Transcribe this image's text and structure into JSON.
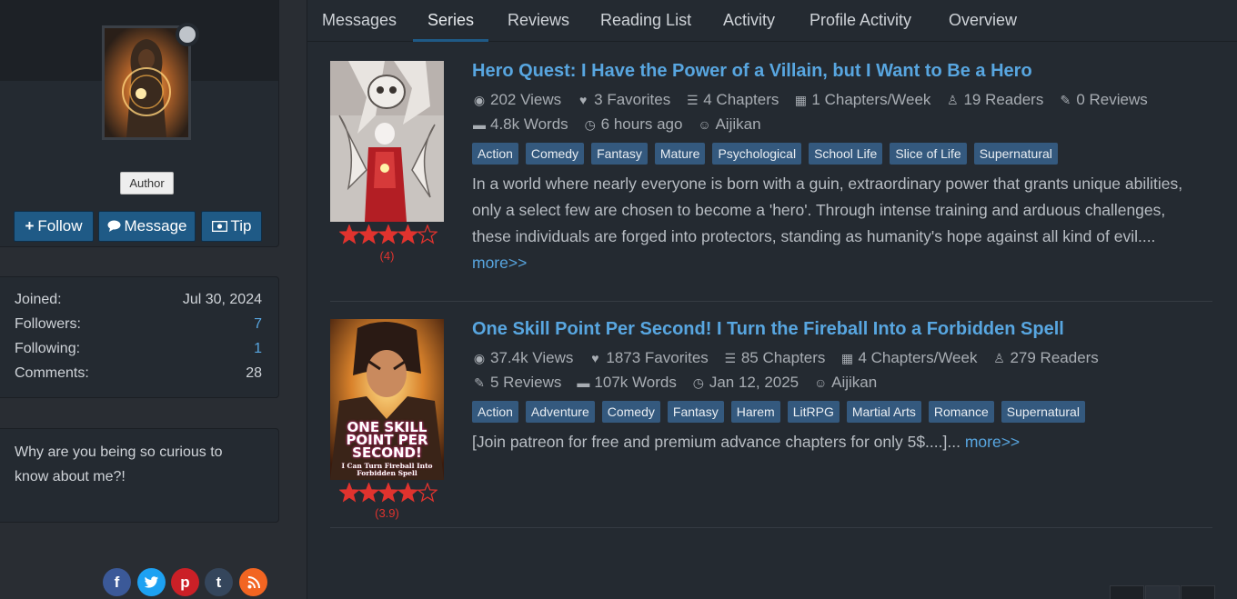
{
  "profile": {
    "username": "Aijikan",
    "badge": "Author",
    "buttons": {
      "follow": "Follow",
      "message": "Message",
      "tip": "Tip"
    }
  },
  "stats": [
    {
      "label": "Joined:",
      "value": "Jul 30, 2024"
    },
    {
      "label": "Followers:",
      "value": "7"
    },
    {
      "label": "Following:",
      "value": "1"
    },
    {
      "label": "Comments:",
      "value": "28"
    }
  ],
  "about": "Why are you being so curious to know about me?!",
  "social_icons": [
    "facebook-icon",
    "twitter-icon",
    "pinterest-icon",
    "tumblr-icon",
    "rss-icon"
  ],
  "tabs": [
    "Messages",
    "Series",
    "Reviews",
    "Reading List",
    "Activity",
    "Profile Activity",
    "Overview"
  ],
  "active_tab": "Series",
  "series": [
    {
      "title": "Hero Quest: I Have the Power of a Villain, but I Want to Be a Hero",
      "rating": 4,
      "rating_label": "(4)",
      "meta_line1": [
        {
          "icon": "eye-icon",
          "text": "202 Views"
        },
        {
          "icon": "heart-icon",
          "text": "3 Favorites"
        },
        {
          "icon": "list-icon",
          "text": "4 Chapters"
        },
        {
          "icon": "calendar-icon",
          "text": "1 Chapters/Week"
        },
        {
          "icon": "user-icon",
          "text": "19 Readers"
        },
        {
          "icon": "edit-icon",
          "text": "0 Reviews"
        }
      ],
      "meta_line2": [
        {
          "icon": "book-icon",
          "text": "4.8k Words"
        },
        {
          "icon": "clock-icon",
          "text": "6 hours ago"
        },
        {
          "icon": "user-circle-icon",
          "text": "Aijikan"
        }
      ],
      "genres": [
        "Action",
        "Comedy",
        "Fantasy",
        "Mature",
        "Psychological",
        "School Life",
        "Slice of Life",
        "Supernatural"
      ],
      "synopsis": "In a world where nearly everyone is born with a guin, extraordinary power that grants unique abilities, only a select few are chosen to become a 'hero'. Through intense training and arduous challenges, these individuals are forged into protectors, standing as humanity's hope against all kind of evil....",
      "more": "more>>"
    },
    {
      "title": "One Skill Point Per Second! I Turn the Fireball Into a Forbidden Spell",
      "rating": 3.9,
      "rating_label": "(3.9)",
      "cover_text": "ONE SKILL POINT PER SECOND!",
      "cover_subtext": "I Can Turn Fireball Into Forbidden Spell",
      "meta_line1": [
        {
          "icon": "eye-icon",
          "text": "37.4k Views"
        },
        {
          "icon": "heart-icon",
          "text": "1873 Favorites"
        },
        {
          "icon": "list-icon",
          "text": "85 Chapters"
        },
        {
          "icon": "calendar-icon",
          "text": "4 Chapters/Week"
        },
        {
          "icon": "user-icon",
          "text": "279 Readers"
        }
      ],
      "meta_line2": [
        {
          "icon": "edit-icon",
          "text": "5 Reviews"
        },
        {
          "icon": "book-icon",
          "text": "107k Words"
        },
        {
          "icon": "clock-icon",
          "text": "Jan 12, 2025"
        },
        {
          "icon": "user-circle-icon",
          "text": "Aijikan"
        }
      ],
      "genres": [
        "Action",
        "Adventure",
        "Comedy",
        "Fantasy",
        "Harem",
        "LitRPG",
        "Martial Arts",
        "Romance",
        "Supernatural"
      ],
      "synopsis": "[Join patreon for free and premium advance chapters for only 5$....]...",
      "more": "more>>"
    }
  ],
  "colors": {
    "accent": "#58a6e0",
    "button": "#1f5a86",
    "genre_bg": "#34597e",
    "star": "#e0332e"
  }
}
